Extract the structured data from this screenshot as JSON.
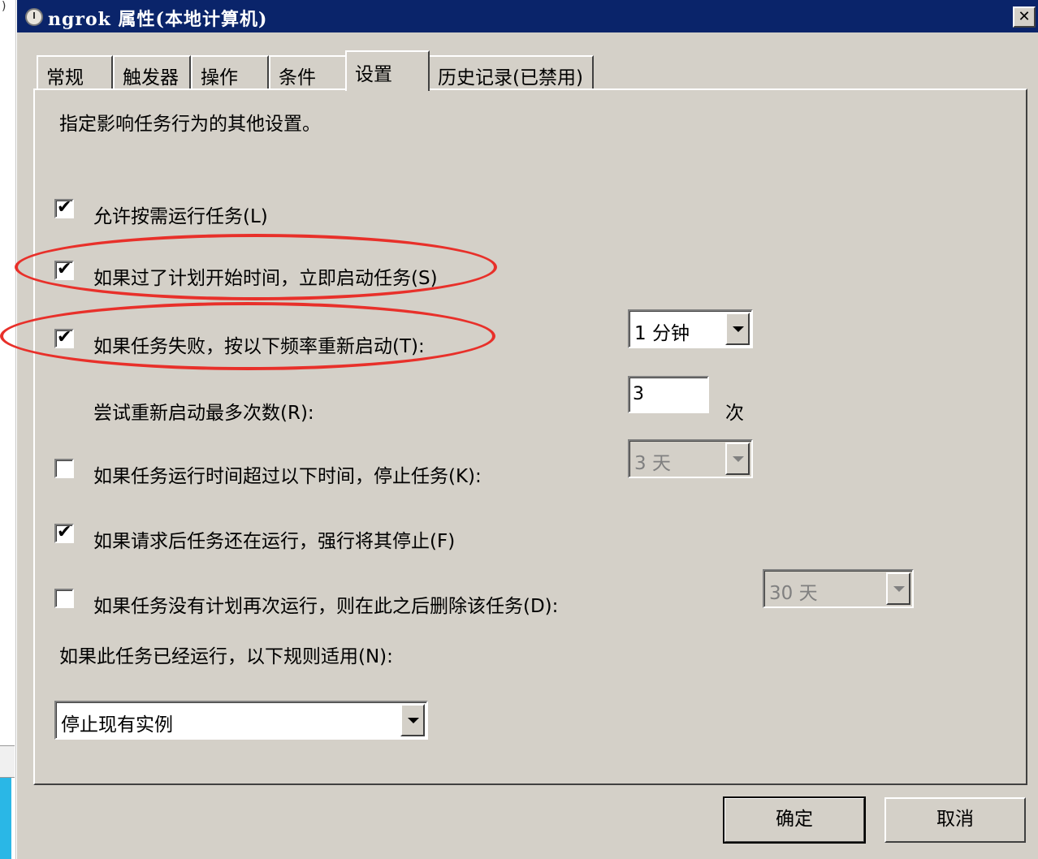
{
  "window": {
    "title": "ngrok 属性(本地计算机)",
    "close_label": "✕"
  },
  "tabs": [
    {
      "label": "常规"
    },
    {
      "label": "触发器"
    },
    {
      "label": "操作"
    },
    {
      "label": "条件"
    },
    {
      "label": "设置",
      "active": true
    },
    {
      "label": "历史记录(已禁用)"
    }
  ],
  "settings": {
    "description": "指定影响任务行为的其他设置。",
    "allow_on_demand": {
      "label": "允许按需运行任务(L)",
      "checked": true
    },
    "start_if_missed": {
      "label": "如果过了计划开始时间，立即启动任务(S)",
      "checked": true
    },
    "restart_on_fail": {
      "label": "如果任务失败，按以下频率重新启动(T):",
      "checked": true,
      "interval": "1 分钟"
    },
    "restart_attempts": {
      "label": "尝试重新启动最多次数(R):",
      "value": "3",
      "unit": "次"
    },
    "stop_if_runs_longer": {
      "label": "如果任务运行时间超过以下时间，停止任务(K):",
      "checked": false,
      "duration": "3 天"
    },
    "force_stop": {
      "label": "如果请求后任务还在运行，强行将其停止(F)",
      "checked": true
    },
    "delete_if_not_scheduled": {
      "label": "如果任务没有计划再次运行，则在此之后删除该任务(D):",
      "checked": false,
      "duration": "30 天"
    },
    "running_rule": {
      "label": "如果此任务已经运行，以下规则适用(N):",
      "value": "停止现有实例"
    }
  },
  "buttons": {
    "ok": "确定",
    "cancel": "取消"
  },
  "check_glyph": "✔",
  "annotation_color": "#e8302a"
}
